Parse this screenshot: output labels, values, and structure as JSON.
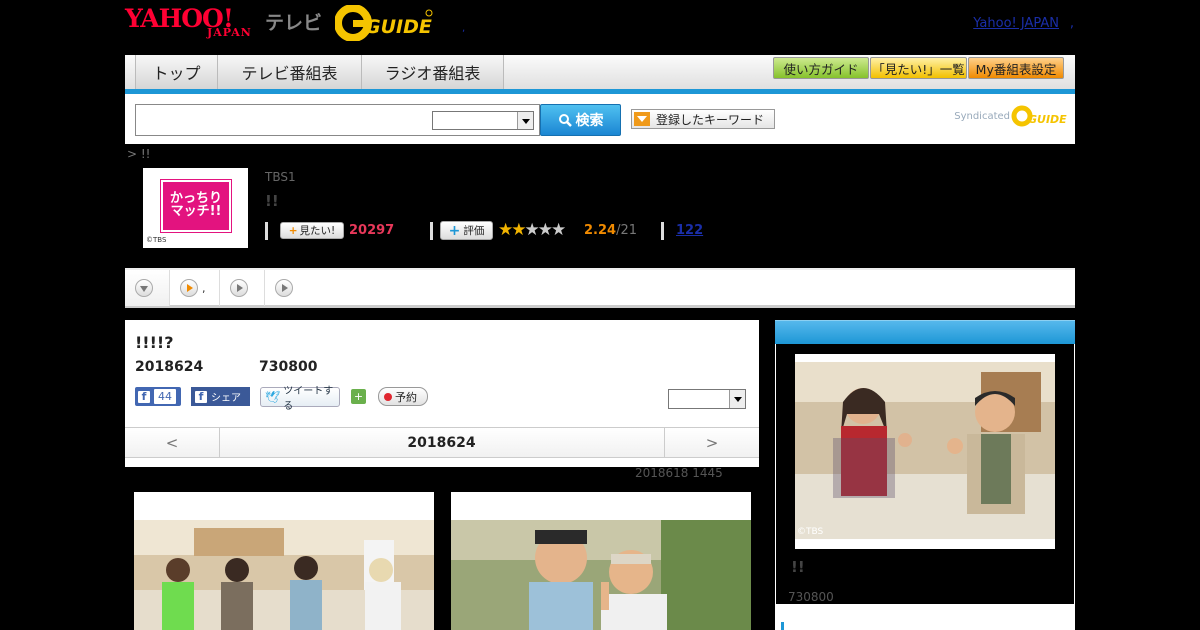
{
  "header": {
    "logo_yahoo": "YAHOO!",
    "logo_japan": "JAPAN",
    "logo_tv": "テレビ",
    "logo_gguide": "GUIDE",
    "dot": ",",
    "link_yahoo": "Yahoo! JAPAN",
    "link_sep": ","
  },
  "nav": {
    "tabs": [
      "トップ",
      "テレビ番組表",
      "ラジオ番組表"
    ],
    "buttons": [
      "使い方ガイド",
      "「見たい!」一覧",
      "My番組表設定"
    ]
  },
  "search": {
    "placeholder": "",
    "button_label": "検索",
    "keyword_button": "登録したキーワード",
    "syndicated": "Syndicated"
  },
  "breadcrumb": "> !!",
  "program": {
    "thumb_text": "かっちり マッチ!!",
    "thumb_copyright": "©TBS",
    "channel": "TBS1",
    "title": "!!",
    "mitai_label": "見たい!",
    "mitai_count": "20297",
    "hyoka_label": "評価",
    "rating": 2.24,
    "rating_text": "2.24",
    "rating_den": "/21",
    "review_count": "122"
  },
  "subtabs": [
    ",",
    "",
    ""
  ],
  "detail": {
    "title": "!!!!?",
    "date": "2018624",
    "time": "730800",
    "fb_like_count": "44",
    "fb_share": "シェア",
    "tweet": "ツイートする",
    "reserve": "予約",
    "pager_prev": "<",
    "pager_date": "2018624",
    "pager_next": ">",
    "updated": "2018618  1445"
  },
  "side": {
    "photo_copyright": "©TBS",
    "name": "!!",
    "time": "730800"
  },
  "colors": {
    "accent": "#1d97d6",
    "brand_red": "#ff0033",
    "count_red": "#e8385a",
    "star": "#f2b400"
  }
}
